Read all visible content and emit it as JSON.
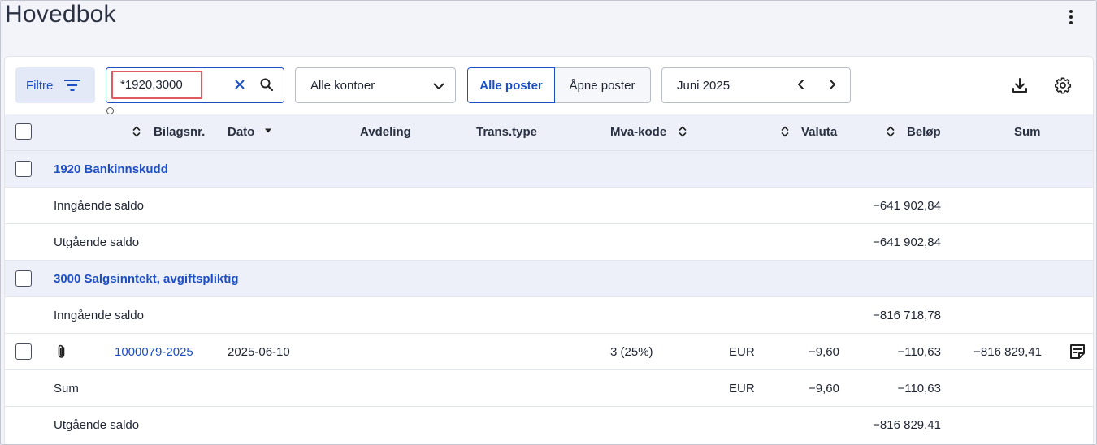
{
  "page": {
    "title": "Hovedbok"
  },
  "toolbar": {
    "filter_label": "Filtre",
    "search_value": "*1920,3000",
    "accounts_select": "Alle kontoer",
    "seg_all": "Alle poster",
    "seg_open": "Åpne poster",
    "period": "Juni 2025"
  },
  "table": {
    "headers": {
      "bilagsnr": "Bilagsnr.",
      "dato": "Dato",
      "avdeling": "Avdeling",
      "transtype": "Trans.type",
      "mvakode": "Mva-kode",
      "valuta": "Valuta",
      "belop": "Beløp",
      "sum": "Sum"
    },
    "groups": [
      {
        "account": "1920 Bankinnskudd",
        "opening_label": "Inngående saldo",
        "opening_amount": "−641 902,84",
        "closing_label": "Utgående saldo",
        "closing_amount": "−641 902,84"
      },
      {
        "account": "3000 Salgsinntekt, avgiftspliktig",
        "opening_label": "Inngående saldo",
        "opening_amount": "−816 718,78",
        "entry": {
          "bilagsnr": "1000079-2025",
          "dato": "2025-06-10",
          "mvakode": "3 (25%)",
          "valuta_code": "EUR",
          "valuta_amount": "−9,60",
          "belop": "−110,63",
          "sum": "−816 829,41"
        },
        "sum_row": {
          "label": "Sum",
          "valuta_code": "EUR",
          "valuta_amount": "−9,60",
          "belop": "−110,63"
        },
        "closing_label": "Utgående saldo",
        "closing_amount": "−816 829,41"
      }
    ]
  },
  "colors": {
    "accent": "#1d4fc4",
    "highlight": "#e05a62",
    "header_bg": "#eef0f9"
  },
  "icons": [
    "filter-icon",
    "close-icon",
    "search-icon",
    "chevron-down-icon",
    "chevron-left-icon",
    "chevron-right-icon",
    "download-icon",
    "gear-icon",
    "kebab-menu-icon",
    "sort-icon",
    "paperclip-icon",
    "note-icon"
  ]
}
